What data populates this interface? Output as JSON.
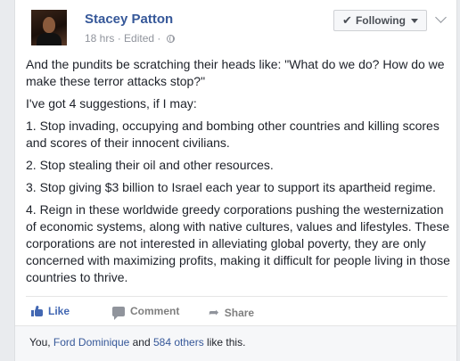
{
  "author": {
    "name": "Stacey Patton",
    "time": "18 hrs",
    "edited": "Edited"
  },
  "follow_button": {
    "label": "Following"
  },
  "post": {
    "paragraphs": [
      "And the pundits be scratching their heads like: \"What do we do? How do we make these terror attacks stop?\"",
      "I've got 4 suggestions, if I may:",
      "1. Stop invading, occupying and bombing other countries and killing scores and scores of their innocent civilians.",
      "2. Stop stealing their oil and other resources.",
      "3. Stop giving $3 billion to Israel each year to support its apartheid regime.",
      "4. Reign in these worldwide greedy corporations pushing the westernization of economic systems, along with native cultures, values and lifestyles. These corporations are not interested in alleviating global poverty, they are only concerned with maximizing profits, making it difficult for people living in those countries to thrive."
    ]
  },
  "actions": {
    "like": "Like",
    "comment": "Comment",
    "share": "Share"
  },
  "likes": {
    "prefix": "You, ",
    "friend": "Ford Dominique",
    "and": " and ",
    "others": "584 others",
    "suffix": " like this."
  },
  "colors": {
    "link": "#365899",
    "like_active": "#4267b2",
    "muted": "#90949c"
  },
  "icons": [
    "globe-icon",
    "check-icon",
    "caret-down-icon",
    "chevron-down-icon",
    "like-icon",
    "comment-icon",
    "share-icon"
  ]
}
